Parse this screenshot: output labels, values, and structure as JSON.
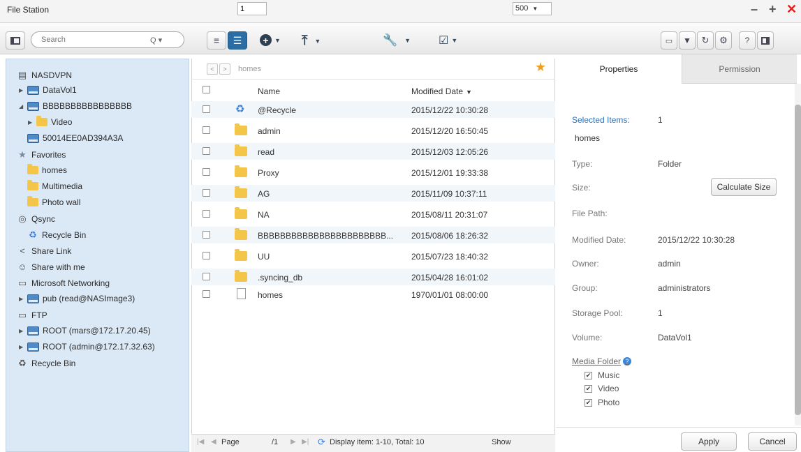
{
  "app": {
    "title": "File Station"
  },
  "toolbar": {
    "search_placeholder": "Search",
    "search_icon_label": "Q ▾"
  },
  "tree": {
    "root": "NASDVPN",
    "datavol": "DataVol1",
    "usb_disk": "BBBBBBBBBBBBBBBB",
    "video": "Video",
    "disk_id": "50014EE0AD394A3A",
    "favorites": "Favorites",
    "fav_homes": "homes",
    "fav_multimedia": "Multimedia",
    "fav_photowall": "Photo wall",
    "qsync": "Qsync",
    "qsync_recycle": "Recycle Bin",
    "share_link": "Share Link",
    "share_with_me": "Share with me",
    "ms_networking": "Microsoft Networking",
    "pub": "pub (read@NASImage3)",
    "ftp": "FTP",
    "root_mars": "ROOT (mars@172.17.20.45)",
    "root_admin": "ROOT (admin@172.17.32.63)",
    "recycle_bin": "Recycle Bin"
  },
  "pathbar": {
    "path": "homes"
  },
  "files": {
    "header_name": "Name",
    "header_date": "Modified Date",
    "rows": [
      {
        "name": "@Recycle",
        "date": "2015/12/22 10:30:28"
      },
      {
        "name": "admin",
        "date": "2015/12/20 16:50:45"
      },
      {
        "name": "read",
        "date": "2015/12/03 12:05:26"
      },
      {
        "name": "Proxy",
        "date": "2015/12/01 19:33:38"
      },
      {
        "name": "AG",
        "date": "2015/11/09 10:37:11"
      },
      {
        "name": "NA",
        "date": "2015/08/11 20:31:07"
      },
      {
        "name": "BBBBBBBBBBBBBBBBBBBBBBB...",
        "date": "2015/08/06 18:26:32"
      },
      {
        "name": "UU",
        "date": "2015/07/23 18:40:32"
      },
      {
        "name": ".syncing_db",
        "date": "2015/04/28 16:01:02"
      },
      {
        "name": "homes",
        "date": "1970/01/01 08:00:00"
      }
    ]
  },
  "pager": {
    "page_label": "Page",
    "page_value": "1",
    "page_total": "/1",
    "display": "Display item: 1-10, Total: 10",
    "show_label": "Show",
    "show_value": "500"
  },
  "properties": {
    "tab_properties": "Properties",
    "tab_permission": "Permission",
    "selected_items_label": "Selected Items:",
    "selected_items_value": "1",
    "folder_name": "homes",
    "type_label": "Type:",
    "type_value": "Folder",
    "size_label": "Size:",
    "calc_size": "Calculate Size",
    "filepath_label": "File Path:",
    "modified_label": "Modified Date:",
    "modified_value": "2015/12/22 10:30:28",
    "owner_label": "Owner:",
    "owner_value": "admin",
    "group_label": "Group:",
    "group_value": "administrators",
    "pool_label": "Storage Pool:",
    "pool_value": "1",
    "volume_label": "Volume:",
    "volume_value": "DataVol1",
    "media_folder_label": "Media Folder",
    "media_music": "Music",
    "media_video": "Video",
    "media_photo": "Photo",
    "apply": "Apply",
    "cancel": "Cancel"
  },
  "colors": {
    "accent": "#2a6ea5",
    "tree_bg": "#dbe8f5",
    "folder": "#f3c64a",
    "link_blue": "#2a6ebb",
    "close_red": "#e02020"
  }
}
